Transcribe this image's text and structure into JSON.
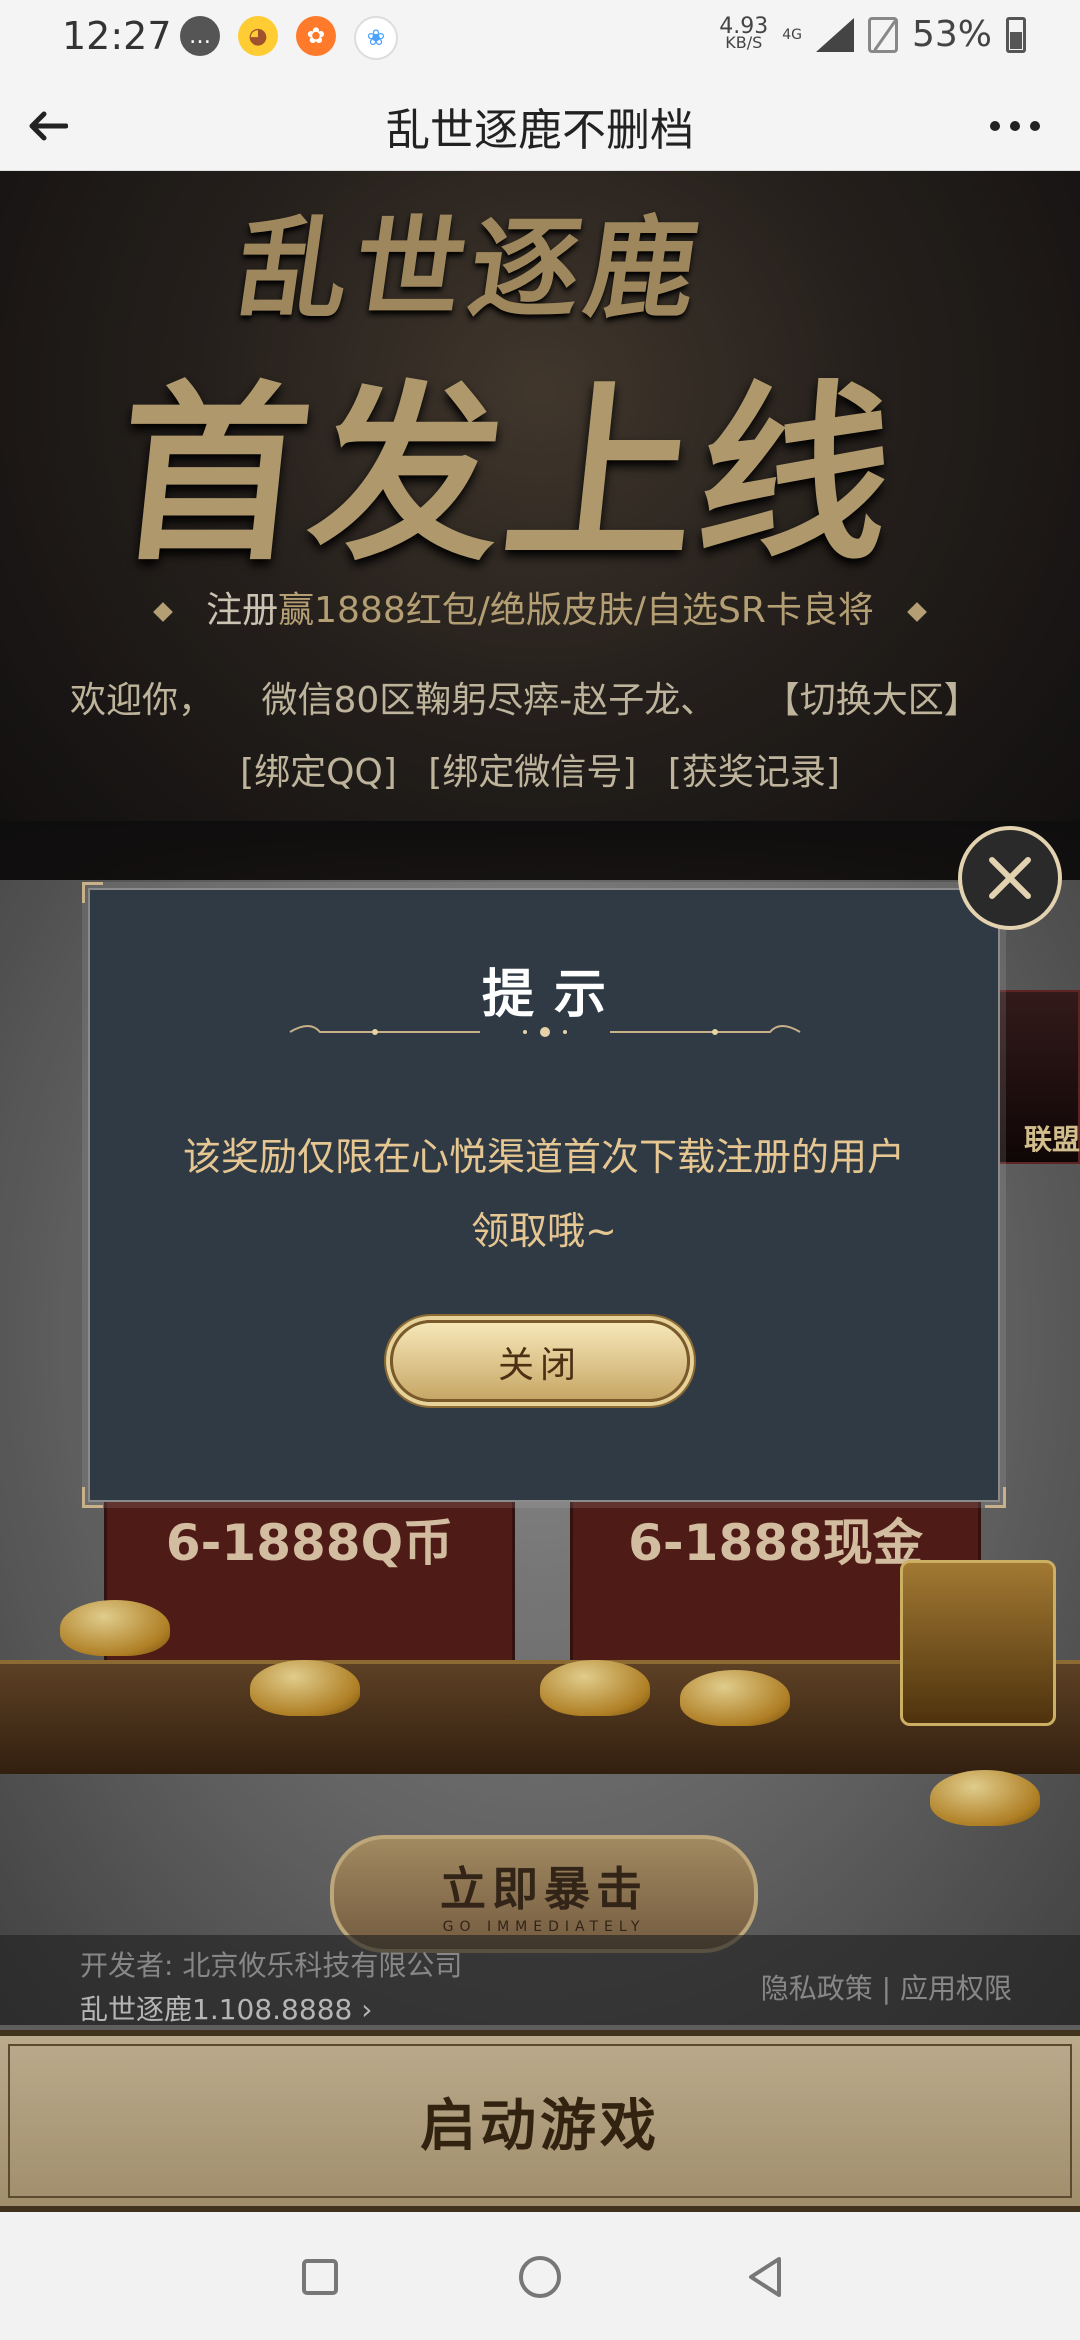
{
  "status_bar": {
    "time": "12:27",
    "net_speed_value": "4.93",
    "net_speed_unit": "KB/S",
    "network_type": "4G",
    "battery": "53%"
  },
  "app_bar": {
    "title": "乱世逐鹿不删档"
  },
  "hero": {
    "logo_line1": "乱世逐鹿",
    "logo_line2": "首发上线",
    "promo_prefix": "注册",
    "promo_text": "赢1888红包/绝版皮肤/自选SR卡良将",
    "welcome_prefix": "欢迎你，",
    "welcome_user": "微信80区鞠躬尽瘁-赵子龙、",
    "switch_zone": "【切换大区】",
    "bind_qq": "[绑定QQ]",
    "bind_wechat": "[绑定微信号]",
    "prize_record": "[获奖记录]"
  },
  "side_card": {
    "label": "联盟"
  },
  "prizes": {
    "left_label": "6-1888Q币",
    "right_label": "6-1888现金"
  },
  "burst_button": {
    "label": "立即暴击",
    "sublabel": "GO IMMEDIATELY"
  },
  "footer": {
    "developer": "开发者: 北京攸乐科技有限公司",
    "version": "乱世逐鹿1.108.8888 ›",
    "privacy": "隐私政策",
    "separator": " | ",
    "permissions": "应用权限"
  },
  "start_button": {
    "label": "启动游戏"
  },
  "modal": {
    "title": "提示",
    "message_line1": "该奖励仅限在心悦渠道首次下载注册的用户",
    "message_line2": "领取哦~",
    "close_label": "关闭"
  },
  "colors": {
    "gold_text": "#e6c691",
    "modal_bg": "#2f3a45",
    "dark_red": "#5b1f1a"
  }
}
